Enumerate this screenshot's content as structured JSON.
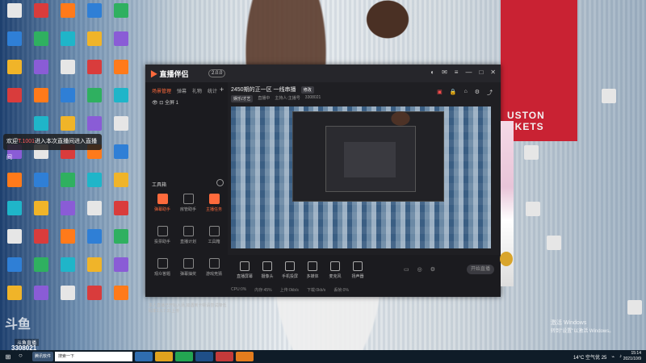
{
  "desktop": {
    "rockets_text": "USTON\nCKETS",
    "toast": {
      "prefix": "欢迎",
      "highlight": "T.1001",
      "suffix": "进入本次直播间进入直播间"
    },
    "watermark": "斗鱼",
    "watermark_sub": "斗鱼直播",
    "watermark_id": "3308021"
  },
  "app": {
    "logo": "直播伴侣",
    "version_badge": "2.0.0",
    "tabs": [
      "场景管理",
      "弹幕",
      "礼物",
      "统计"
    ],
    "scene_label": "全屏 1",
    "tools_title": "工具箱",
    "tools": [
      {
        "label": "弹幕助手",
        "hot": true
      },
      {
        "label": "房管助手",
        "hot": false
      },
      {
        "label": "主播任务",
        "hot": true
      },
      {
        "label": "投票助手",
        "hot": false
      },
      {
        "label": "直播计划",
        "hot": false
      },
      {
        "label": "工具箱",
        "hot": false
      },
      {
        "label": "观众答题",
        "hot": false
      },
      {
        "label": "弹幕抽奖",
        "hot": false
      },
      {
        "label": "游戏竞猜",
        "hot": false
      }
    ],
    "status_msg": "本人直播已开始入场,如遇到卡顿请尝试降低码率1.5.7.31上传",
    "room_title": "2450期的正一区 一线串播",
    "room_badge": "修改",
    "room_sub": [
      "娱乐/才艺",
      "直播中",
      "主持人:主播号",
      "3308021"
    ],
    "controls": [
      "直播屏幕",
      "摄像头",
      "手机投屏",
      "多媒体",
      "麦克风",
      "扬声器"
    ],
    "start_button": "开始直播",
    "stats": [
      "CPU:0%",
      "内存:45%",
      "上传:0kb/s",
      "下载:0kb/s",
      "丢帧:0%"
    ]
  },
  "system": {
    "activate_title": "激活 Windows",
    "activate_sub": "转到\"设置\"以激活 Windows。",
    "search_placeholder": "搜索一下",
    "taskbar_selected": "腾讯软件",
    "weather": "14°C 空气优 25",
    "time": "15:14",
    "date": "2021/10/9"
  }
}
